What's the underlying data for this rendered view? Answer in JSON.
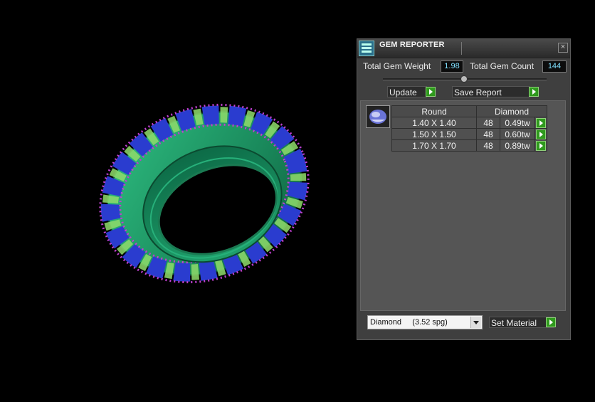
{
  "window": {
    "title": "GEM REPORTER",
    "close_glyph": "×",
    "icon": "gem-reporter-app-icon"
  },
  "stats": {
    "weight_label": "Total Gem Weight",
    "weight_value": "1.98",
    "count_label": "Total Gem Count",
    "count_value": "144"
  },
  "actions": {
    "update_label": "Update",
    "save_label": "Save Report",
    "set_material_label": "Set Material"
  },
  "table": {
    "shape": "Round",
    "material": "Diamond",
    "rows": [
      {
        "size": "1.40 X 1.40",
        "count": "48",
        "weight": "0.49tw"
      },
      {
        "size": "1.50 X 1.50",
        "count": "48",
        "weight": "0.60tw"
      },
      {
        "size": "1.70 X 1.70",
        "count": "48",
        "weight": "0.89tw"
      }
    ]
  },
  "material_select": {
    "selected": "Diamond     (3.52 spg)"
  },
  "colors": {
    "metal": "#1f9a6a",
    "gem_blue": "#2a3ccf",
    "accent_pave": "#c040d0",
    "play_button": "#2f9a1d",
    "stat_text": "#7fe0ff"
  }
}
